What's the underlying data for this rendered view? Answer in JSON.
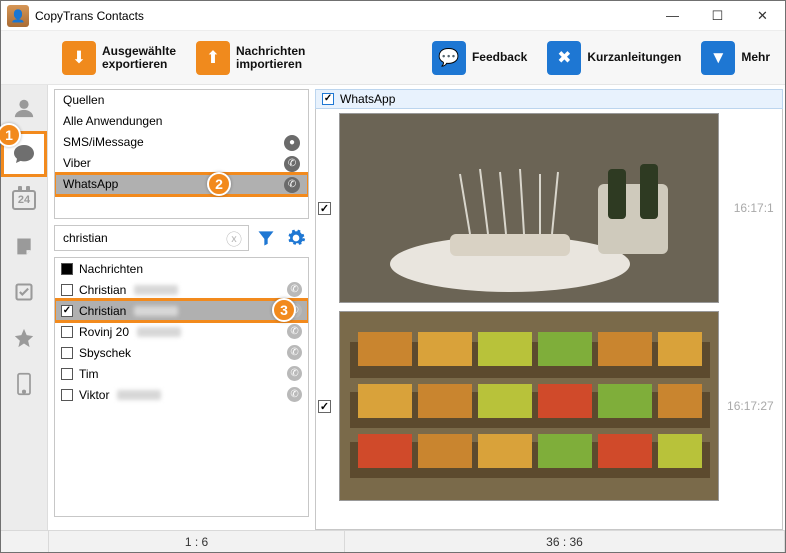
{
  "window": {
    "title": "CopyTrans Contacts"
  },
  "toolbar": {
    "export_label": "Ausgewählte\nexportieren",
    "import_label": "Nachrichten\nimportieren",
    "feedback_label": "Feedback",
    "guides_label": "Kurzanleitungen",
    "more_label": "Mehr"
  },
  "sidebar": {
    "calendar_day": "24"
  },
  "sources": {
    "items": [
      {
        "label": "Quellen",
        "icon": ""
      },
      {
        "label": "Alle Anwendungen",
        "icon": ""
      },
      {
        "label": "SMS/iMessage",
        "icon": "chat"
      },
      {
        "label": "Viber",
        "icon": "phone"
      },
      {
        "label": "WhatsApp",
        "icon": "phone",
        "selected": true
      }
    ]
  },
  "search": {
    "value": "christian"
  },
  "chats": {
    "header": "Nachrichten",
    "items": [
      {
        "label": "Christian",
        "checked": false
      },
      {
        "label": "Christian",
        "checked": true,
        "selected": true
      },
      {
        "label": "Rovinj 20",
        "checked": false
      },
      {
        "label": "Sbyschek",
        "checked": false
      },
      {
        "label": "Tim",
        "checked": false
      },
      {
        "label": "Viktor",
        "checked": false
      }
    ]
  },
  "conversation": {
    "header": "WhatsApp",
    "messages": [
      {
        "time": "16:17:1"
      },
      {
        "time": "16:17:27"
      }
    ]
  },
  "status": {
    "left": "1 : 6",
    "right": "36 : 36"
  },
  "badges": {
    "b1": "1",
    "b2": "2",
    "b3": "3"
  }
}
